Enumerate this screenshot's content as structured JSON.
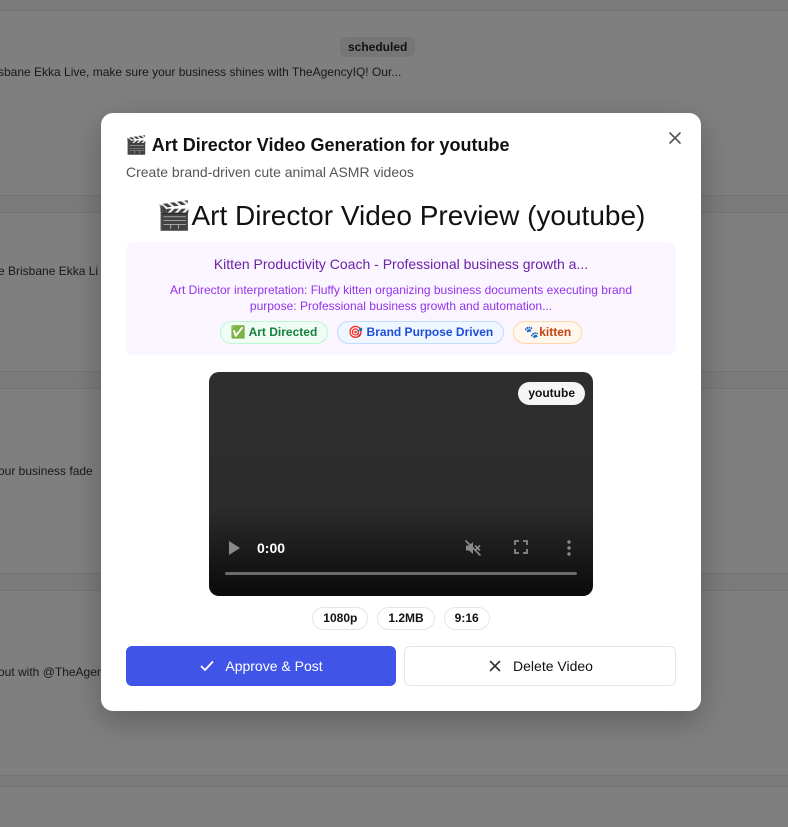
{
  "background": {
    "badge": "scheduled",
    "lines": [
      "sbane Ekka Live, make sure your business shines with TheAgencyIQ! Our...",
      "e Brisbane Ekka Li",
      "our business fade",
      "out with @TheAgen"
    ]
  },
  "modal": {
    "title": "🎬 Art Director Video Generation for youtube",
    "subtitle": "Create brand-driven cute animal ASMR videos",
    "preview_heading": "🎬Art Director Video Preview (youtube)",
    "info": {
      "title": "Kitten Productivity Coach - Professional business growth a...",
      "description": "Art Director interpretation: Fluffy kitten organizing business documents executing brand purpose: Professional business growth and automation...",
      "chips": [
        "✅ Art Directed",
        "🎯 Brand Purpose Driven",
        "🐾kitten"
      ]
    },
    "video": {
      "platform": "youtube",
      "time": "0:00",
      "progress": 0
    },
    "meta": [
      "1080p",
      "1.2MB",
      "9:16"
    ],
    "actions": {
      "approve": "Approve & Post",
      "delete": "Delete Video"
    }
  },
  "colors": {
    "accent": "#4054e8",
    "purple_title": "#6b21a8",
    "purple_text": "#9333ea"
  }
}
